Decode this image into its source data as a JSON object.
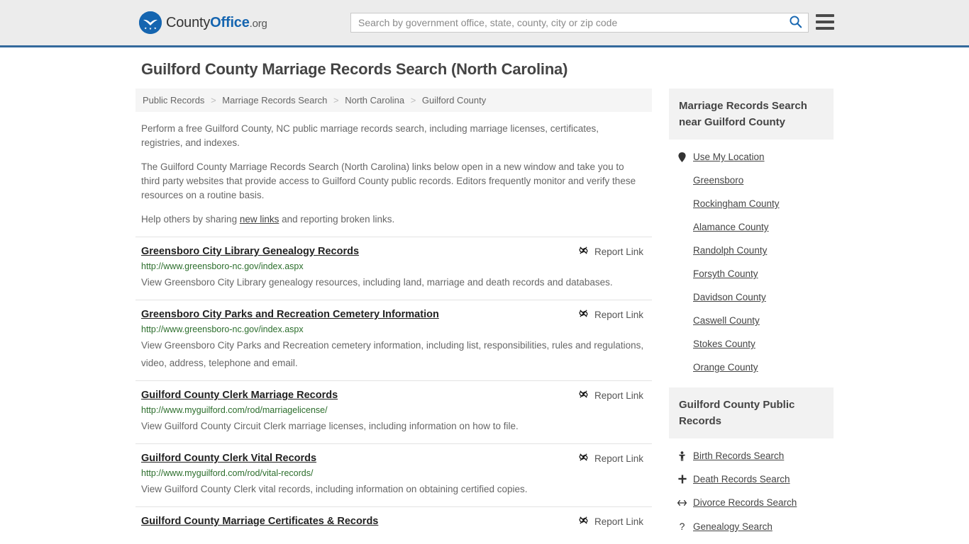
{
  "header": {
    "logo_text_part1": "County",
    "logo_text_part2": "Office",
    "logo_text_part3": ".org",
    "logo_icon": "eagle-shield-icon",
    "search_placeholder": "Search by government office, state, county, city or zip code",
    "search_value": "",
    "search_icon": "search-icon",
    "menu_icon": "hamburger-menu-icon",
    "accent_color": "#33699c",
    "background_color": "#ececec"
  },
  "page": {
    "title": "Guilford County Marriage Records Search (North Carolina)"
  },
  "breadcrumb": {
    "items": [
      {
        "label": "Public Records"
      },
      {
        "label": "Marriage Records Search"
      },
      {
        "label": "North Carolina"
      },
      {
        "label": "Guilford County"
      }
    ],
    "separator": ">"
  },
  "intro": {
    "paragraph1": "Perform a free Guilford County, NC public marriage records search, including marriage licenses, certificates, registries, and indexes.",
    "paragraph2": "The Guilford County Marriage Records Search (North Carolina) links below open in a new window and take you to third party websites that provide access to Guilford County public records. Editors frequently monitor and verify these resources on a routine basis.",
    "paragraph3_pre": "Help others by sharing ",
    "paragraph3_link": "new links",
    "paragraph3_post": " and reporting broken links."
  },
  "results": {
    "report_label": "Report Link",
    "report_icon": "broken-link-icon",
    "items": [
      {
        "title": "Greensboro City Library Genealogy Records",
        "url": "http://www.greensboro-nc.gov/index.aspx",
        "description": "View Greensboro City Library genealogy resources, including land, marriage and death records and databases."
      },
      {
        "title": "Greensboro City Parks and Recreation Cemetery Information",
        "url": "http://www.greensboro-nc.gov/index.aspx",
        "description": "View Greensboro City Parks and Recreation cemetery information, including list, responsibilities, rules and regulations, video, address, telephone and email."
      },
      {
        "title": "Guilford County Clerk Marriage Records",
        "url": "http://www.myguilford.com/rod/marriagelicense/",
        "description": "View Guilford County Circuit Clerk marriage licenses, including information on how to file."
      },
      {
        "title": "Guilford County Clerk Vital Records",
        "url": "http://www.myguilford.com/rod/vital-records/",
        "description": "View Guilford County Clerk vital records, including information on obtaining certified copies."
      },
      {
        "title": "Guilford County Marriage Certificates & Records",
        "url": "",
        "description": ""
      }
    ]
  },
  "sidebar": {
    "nearby": {
      "header": "Marriage Records Search near Guilford County",
      "items": [
        {
          "label": "Use My Location",
          "icon": "map-pin-icon"
        },
        {
          "label": "Greensboro",
          "icon": ""
        },
        {
          "label": "Rockingham County",
          "icon": ""
        },
        {
          "label": "Alamance County",
          "icon": ""
        },
        {
          "label": "Randolph County",
          "icon": ""
        },
        {
          "label": "Forsyth County",
          "icon": ""
        },
        {
          "label": "Davidson County",
          "icon": ""
        },
        {
          "label": "Caswell County",
          "icon": ""
        },
        {
          "label": "Stokes County",
          "icon": ""
        },
        {
          "label": "Orange County",
          "icon": ""
        }
      ]
    },
    "public_records": {
      "header": "Guilford County Public Records",
      "items": [
        {
          "label": "Birth Records Search",
          "icon": "baby-icon"
        },
        {
          "label": "Death Records Search",
          "icon": "cross-icon"
        },
        {
          "label": "Divorce Records Search",
          "icon": "left-right-arrow-icon"
        },
        {
          "label": "Genealogy Search",
          "icon": "question-mark-icon"
        }
      ]
    }
  }
}
